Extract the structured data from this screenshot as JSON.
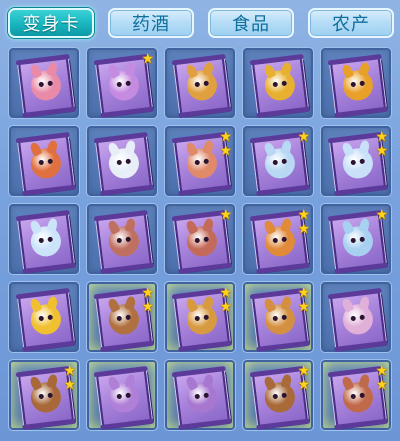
{
  "tabs": [
    {
      "label": "变身卡",
      "active": true
    },
    {
      "label": "药酒",
      "active": false
    },
    {
      "label": "食品",
      "active": false
    },
    {
      "label": "农产",
      "active": false
    }
  ],
  "colors": {
    "tab_active": "#18b4be",
    "tab_inactive": "#b4dcf6",
    "slot_bg": "#5577b5",
    "card": "#a884dc",
    "star": "#ffd21c"
  },
  "slots": [
    {
      "creature": "pink-monkey-icon",
      "color": "#e88aa8",
      "stars": 0,
      "glow": false
    },
    {
      "creature": "purple-bird-icon",
      "color": "#c58be0",
      "stars": 1,
      "glow": false
    },
    {
      "creature": "lion-dancer-icon",
      "color": "#e0a040",
      "stars": 0,
      "glow": false
    },
    {
      "creature": "lion-dancer-icon",
      "color": "#e8b030",
      "stars": 0,
      "glow": false
    },
    {
      "creature": "lion-dancer-icon",
      "color": "#e8a028",
      "stars": 0,
      "glow": false
    },
    {
      "creature": "fox-warrior-icon",
      "color": "#e07040",
      "stars": 0,
      "glow": false
    },
    {
      "creature": "white-unicorn-icon",
      "color": "#e8eef8",
      "stars": 0,
      "glow": false
    },
    {
      "creature": "fox-runner-icon",
      "color": "#e08a6a",
      "stars": 2,
      "glow": false
    },
    {
      "creature": "ice-dragon-icon",
      "color": "#b8d8f4",
      "stars": 1,
      "glow": false
    },
    {
      "creature": "ice-dragon-icon",
      "color": "#c8e0f8",
      "stars": 2,
      "glow": false
    },
    {
      "creature": "crystal-fox-icon",
      "color": "#cce4fa",
      "stars": 0,
      "glow": false
    },
    {
      "creature": "boar-icon",
      "color": "#c07060",
      "stars": 0,
      "glow": false
    },
    {
      "creature": "boar-icon",
      "color": "#c46a5a",
      "stars": 1,
      "glow": false
    },
    {
      "creature": "armored-warrior-icon",
      "color": "#e08a3a",
      "stars": 2,
      "glow": false
    },
    {
      "creature": "ice-dragon-icon",
      "color": "#a8d0f0",
      "stars": 1,
      "glow": false
    },
    {
      "creature": "yellow-chick-icon",
      "color": "#f0c030",
      "stars": 0,
      "glow": false
    },
    {
      "creature": "monkey-king-icon",
      "color": "#b07040",
      "stars": 2,
      "glow": true
    },
    {
      "creature": "golden-monk-icon",
      "color": "#d89a40",
      "stars": 2,
      "glow": true
    },
    {
      "creature": "golden-monk-icon",
      "color": "#d49040",
      "stars": 2,
      "glow": true
    },
    {
      "creature": "butterfly-spirit-icon",
      "color": "#e0b0d8",
      "stars": 0,
      "glow": false
    },
    {
      "creature": "monkey-king-icon",
      "color": "#a86838",
      "stars": 2,
      "glow": true
    },
    {
      "creature": "purple-dragon-icon",
      "color": "#b080d8",
      "stars": 0,
      "glow": true
    },
    {
      "creature": "purple-dragon-icon",
      "color": "#a878d0",
      "stars": 0,
      "glow": true
    },
    {
      "creature": "monkey-king-icon",
      "color": "#a86a38",
      "stars": 2,
      "glow": true
    },
    {
      "creature": "armored-warrior-icon",
      "color": "#c06a4a",
      "stars": 2,
      "glow": true
    }
  ]
}
